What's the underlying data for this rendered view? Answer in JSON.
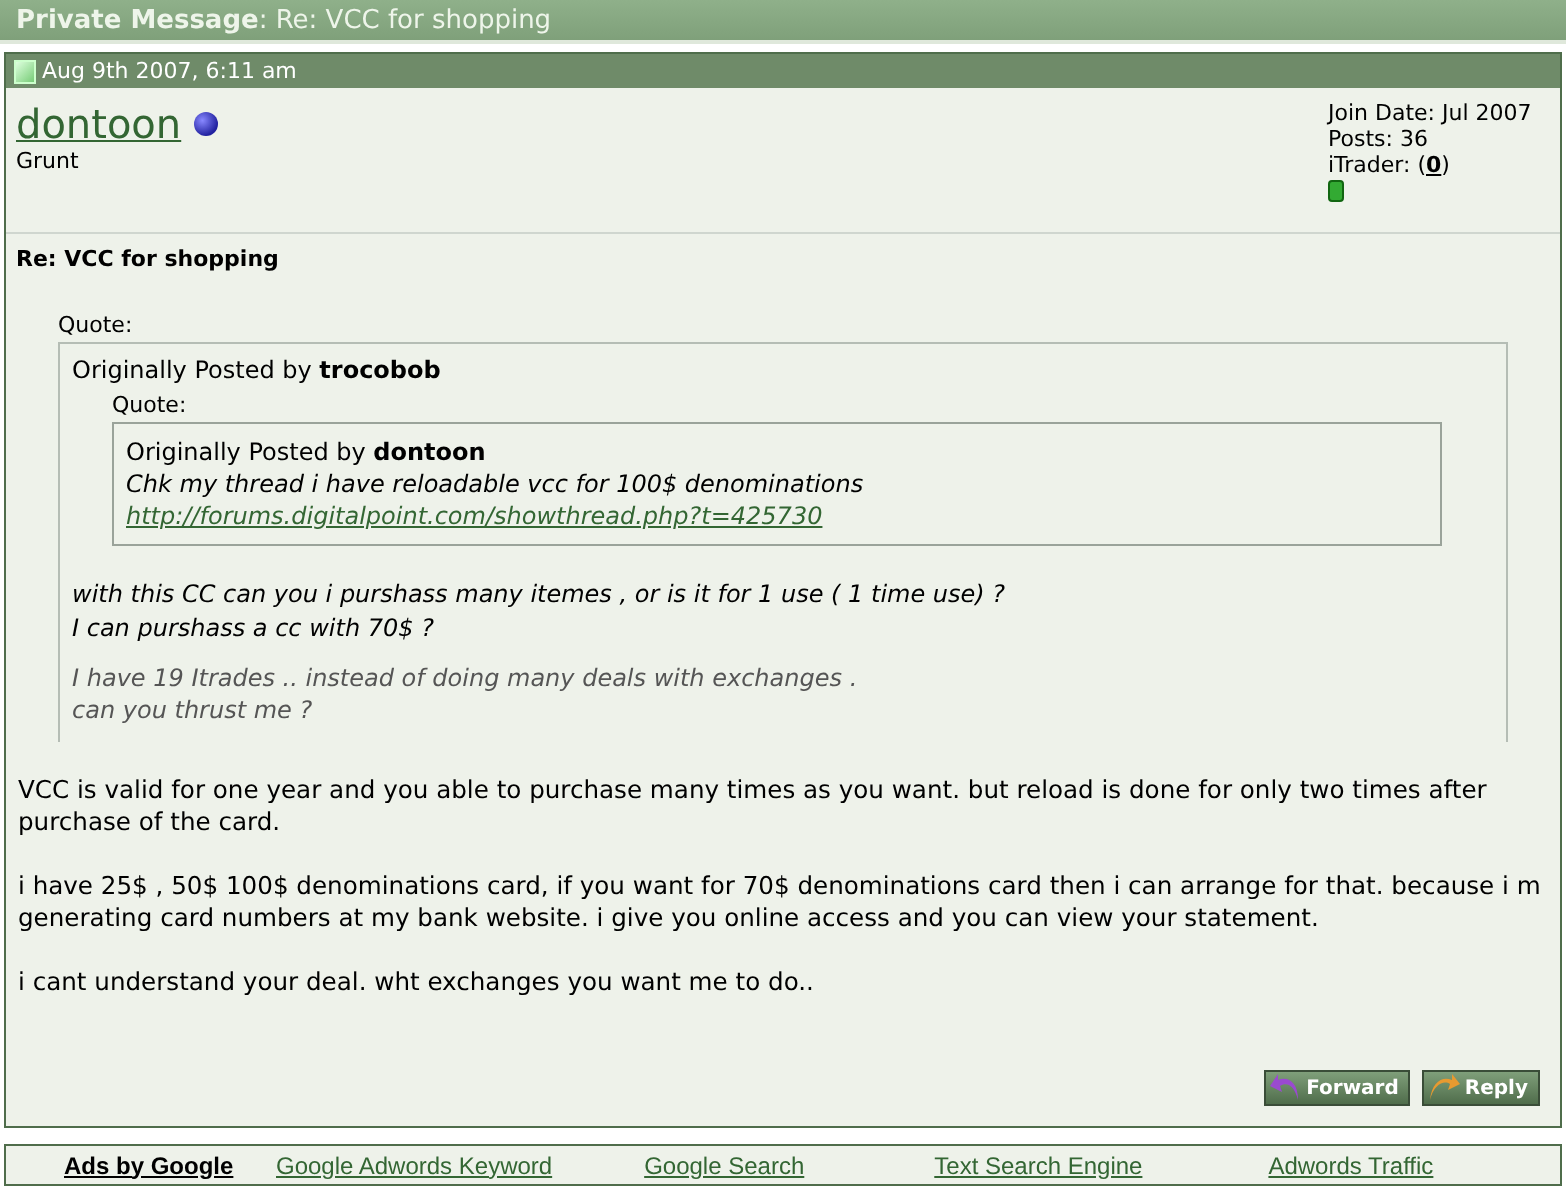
{
  "header": {
    "label": "Private Message",
    "subject": ": Re: VCC for shopping"
  },
  "post": {
    "date": "Aug 9th 2007, 6:11 am",
    "author": "dontoon",
    "rank": "Grunt",
    "user_info": {
      "join_date": "Join Date: Jul 2007",
      "posts": "Posts: 36",
      "itrader_before": "iTrader: (",
      "itrader_link": "0",
      "itrader_after": ")"
    },
    "title": "Re: VCC for shopping",
    "quote": {
      "label": "Quote:",
      "byline": "Originally Posted by **trocobob**",
      "nested_quote": {
        "label": "Quote:",
        "byline": "Originally Posted by **dontoon**",
        "text": "Chk my thread i have reloadable vcc for 100$ denominations",
        "link": "http://forums.digitalpoint.com/showthread.php?t=425730"
      },
      "lines": [
        "with this CC can you i purshass many itemes , or is it for 1 use ( 1 time use) ?",
        "I can purshass a cc with 70$ ?"
      ],
      "faded_lines": [
        "I have 19 Itrades .. instead of doing many deals with exchanges .",
        "can you thrust me ?"
      ]
    },
    "paragraphs": [
      "VCC is valid for one year and you able to purchase many times as you want. but reload is done for only two times after purchase of the card.",
      "i have 25$ , 50$ 100$ denominations card, if you want for 70$ denominations card then i can arrange for that. because i m generating card numbers at my bank website. i give you online access and you can view your statement.",
      "i cant understand your deal. wht exchanges you want me to do.."
    ],
    "buttons": [
      {
        "label": "Forward",
        "kind": "forward"
      },
      {
        "label": "Reply",
        "kind": "reply"
      }
    ]
  },
  "ads": {
    "label": "Ads by Google",
    "links": [
      "Google Adwords Keyword",
      "Google Search",
      "Text Search Engine",
      "Adwords Traffic"
    ]
  }
}
